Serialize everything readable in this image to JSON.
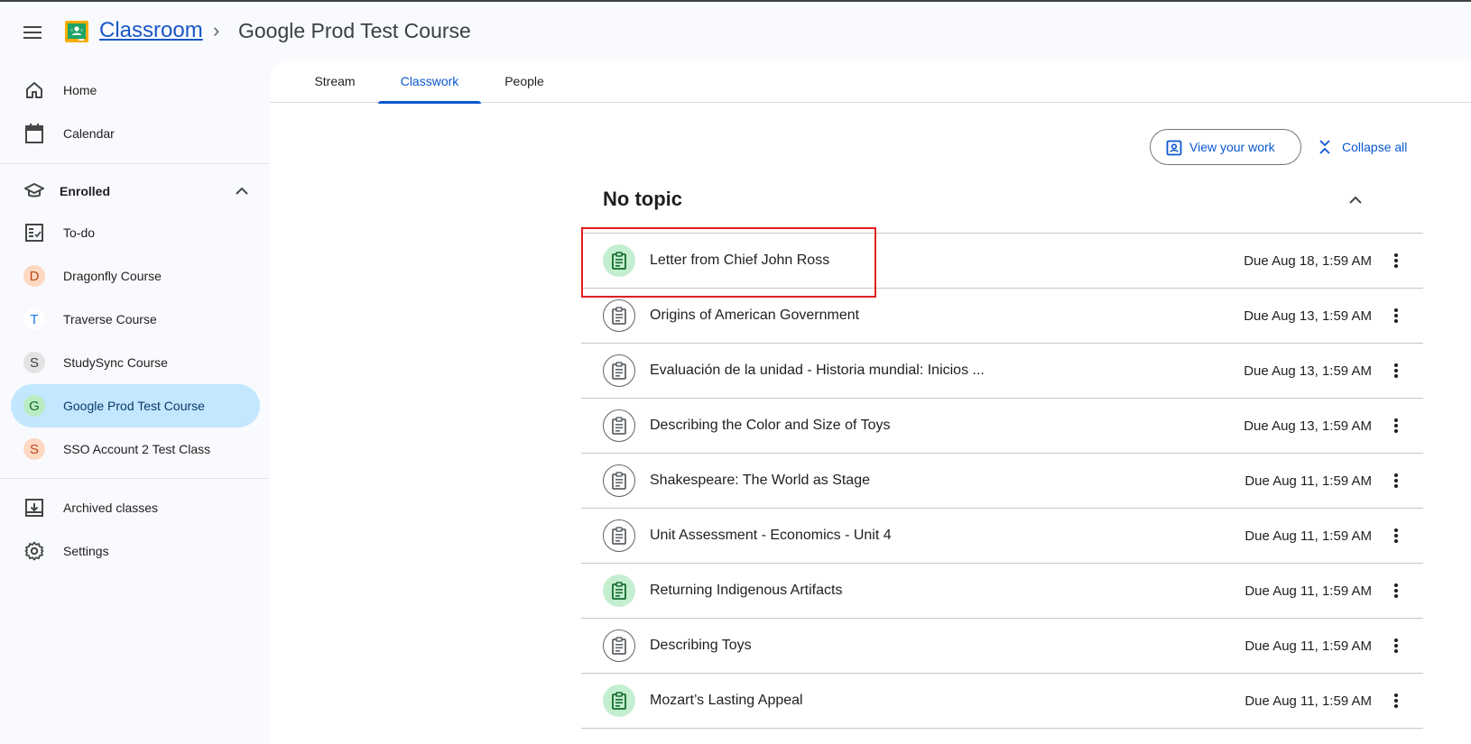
{
  "header": {
    "app_name": "Classroom",
    "breadcrumb_separator": "›",
    "course_title": "Google Prod Test Course"
  },
  "sidebar": {
    "home": "Home",
    "calendar": "Calendar",
    "enrolled": "Enrolled",
    "todo": "To-do",
    "courses": [
      {
        "initial": "D",
        "label": "Dragonfly Course",
        "avatar_bg": "#ffd8c2",
        "avatar_fg": "#b3471b"
      },
      {
        "initial": "T",
        "label": "Traverse Course",
        "avatar_bg": "#ffffff",
        "avatar_fg": "#1a73e8"
      },
      {
        "initial": "S",
        "label": "StudySync Course",
        "avatar_bg": "#e3e3e3",
        "avatar_fg": "#3c4043"
      },
      {
        "initial": "G",
        "label": "Google Prod Test Course",
        "avatar_bg": "#b9ecc3",
        "avatar_fg": "#146c2e"
      },
      {
        "initial": "S",
        "label": "SSO Account 2 Test Class",
        "avatar_bg": "#ffd8c2",
        "avatar_fg": "#b3471b"
      }
    ],
    "archived": "Archived classes",
    "settings": "Settings"
  },
  "tabs": [
    "Stream",
    "Classwork",
    "People"
  ],
  "active_tab": "Classwork",
  "actions": {
    "view_your_work": "View your work",
    "collapse_all": "Collapse all"
  },
  "topic": {
    "title": "No topic",
    "assignments": [
      {
        "title": "Letter from Chief John Ross",
        "due": "Due Aug 18, 1:59 AM",
        "state": "open"
      },
      {
        "title": "Origins of American Government",
        "due": "Due Aug 13, 1:59 AM",
        "state": "done"
      },
      {
        "title": "Evaluación de la unidad - Historia mundial: Inicios ...",
        "due": "Due Aug 13, 1:59 AM",
        "state": "done"
      },
      {
        "title": "Describing the Color and Size of Toys",
        "due": "Due Aug 13, 1:59 AM",
        "state": "done"
      },
      {
        "title": "Shakespeare: The World as Stage",
        "due": "Due Aug 11, 1:59 AM",
        "state": "done"
      },
      {
        "title": "Unit Assessment - Economics - Unit 4",
        "due": "Due Aug 11, 1:59 AM",
        "state": "done"
      },
      {
        "title": "Returning Indigenous Artifacts",
        "due": "Due Aug 11, 1:59 AM",
        "state": "open"
      },
      {
        "title": "Describing Toys",
        "due": "Due Aug 11, 1:59 AM",
        "state": "done"
      },
      {
        "title": "Mozart’s Lasting Appeal",
        "due": "Due Aug 11, 1:59 AM",
        "state": "open"
      }
    ]
  },
  "colors": {
    "accent": "#0b57d0",
    "active_nav_bg": "#c2e7ff",
    "open_assignment_bg": "#c4eed0",
    "open_assignment_icon": "#146c2e",
    "highlight": "#e01e1e"
  }
}
